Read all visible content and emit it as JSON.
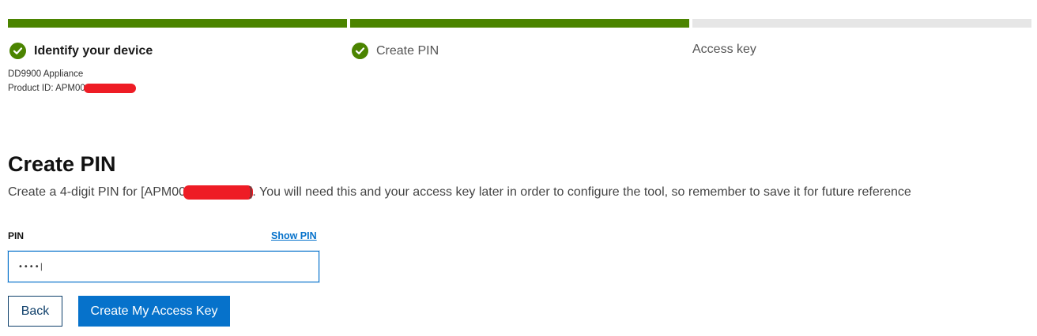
{
  "stepper": {
    "steps": [
      {
        "label": "Identify your device",
        "status": "complete"
      },
      {
        "label": "Create PIN",
        "status": "complete"
      },
      {
        "label": "Access key",
        "status": "pending"
      }
    ],
    "device_name": "DD9900 Appliance",
    "product_id_label": "Product ID: APM00"
  },
  "main": {
    "title": "Create PIN",
    "instruction_prefix": "Create a 4-digit PIN for [APM00",
    "instruction_suffix": "]. You will need this and your access key later in order to configure the tool, so remember to save it for future reference"
  },
  "form": {
    "pin_label": "PIN",
    "show_pin_label": "Show PIN",
    "pin_value": "••••|"
  },
  "buttons": {
    "back_label": "Back",
    "create_label": "Create My Access Key"
  },
  "colors": {
    "progress_complete": "#4b8400",
    "progress_pending": "#e6e6e6",
    "primary": "#0672cb",
    "redaction": "#ee1c25"
  },
  "icons": {
    "step_complete": "check-circle-icon"
  }
}
